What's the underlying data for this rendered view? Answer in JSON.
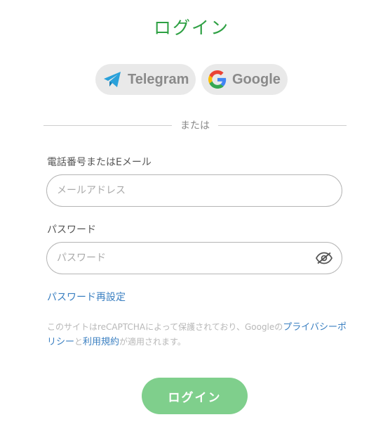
{
  "title": "ログイン",
  "social": {
    "telegram_label": "Telegram",
    "google_label": "Google"
  },
  "divider_text": "または",
  "email": {
    "label": "電話番号またはEメール",
    "placeholder": "メールアドレス",
    "value": ""
  },
  "password": {
    "label": "パスワード",
    "placeholder": "パスワード",
    "value": ""
  },
  "reset_link": "パスワード再設定",
  "notice": {
    "prefix": "このサイトはreCAPTCHAによって保護されており、Googleの",
    "privacy_link": "プライバシーポリシー",
    "middle": "と",
    "terms_link": "利用規約",
    "suffix": "が適用されます。"
  },
  "submit_label": "ログイン",
  "colors": {
    "title_green": "#2ea043",
    "button_green": "#7fcf8c",
    "link_blue": "#3a7fc1"
  }
}
